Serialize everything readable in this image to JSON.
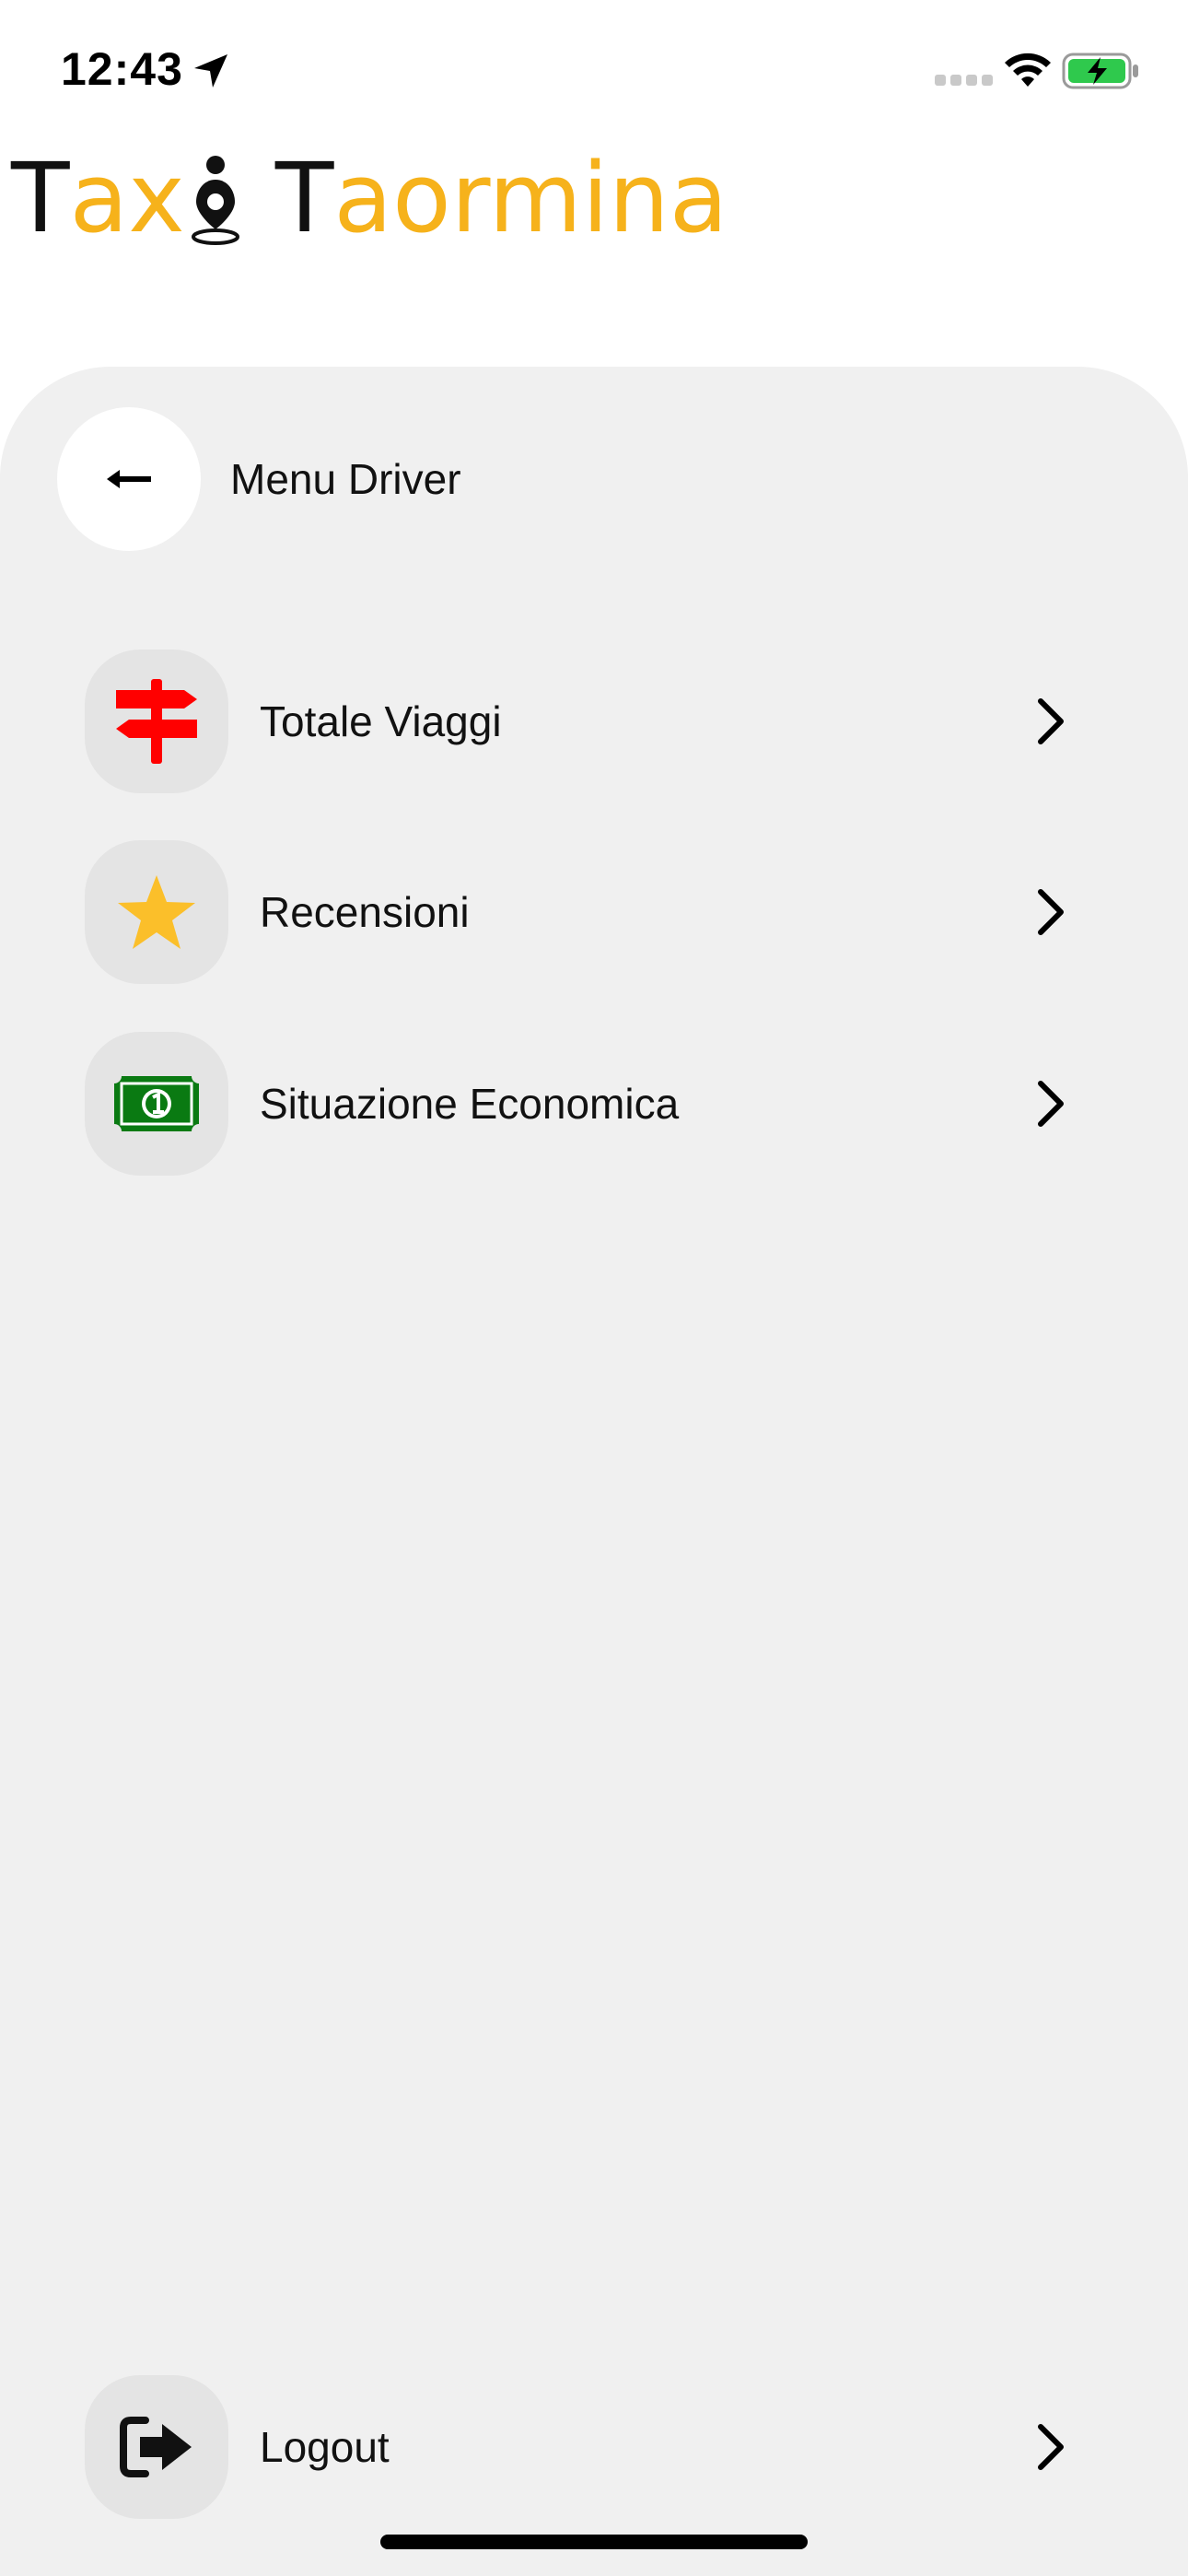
{
  "status_bar": {
    "time": "12:43",
    "icons": [
      "location-arrow-icon",
      "signal-dots-icon",
      "wifi-icon",
      "battery-charging-icon"
    ],
    "battery_color": "#2fc94d"
  },
  "logo": {
    "part1": "T",
    "part2": "ax",
    "part3": "T",
    "part4": "aormina",
    "gold_color": "#f6b21b",
    "dark_color": "#111111"
  },
  "header": {
    "back_icon": "arrow-left-icon",
    "title": "Menu Driver"
  },
  "menu": {
    "items": [
      {
        "label": "Totale Viaggi",
        "icon": "signpost-icon",
        "icon_color": "#ff0000"
      },
      {
        "label": "Recensioni",
        "icon": "star-icon",
        "icon_color": "#fbbf2a"
      },
      {
        "label": "Situazione Economica",
        "icon": "banknote-icon",
        "icon_color": "#0a7a12"
      }
    ]
  },
  "logout": {
    "label": "Logout",
    "icon": "logout-icon"
  },
  "colors": {
    "panel_background": "#f0f0f0",
    "icon_box_background": "#e4e4e4"
  }
}
